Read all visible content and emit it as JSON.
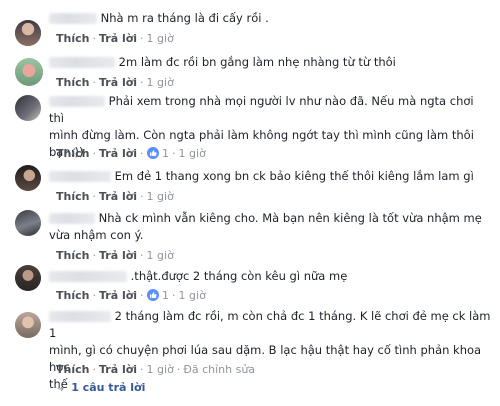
{
  "comments": [
    {
      "lines": [
        "Nhà m ra tháng là đi cấy rồi ."
      ],
      "like": "Thích",
      "reply": "Trả lời",
      "time": "1 giờ",
      "likes": null,
      "edited": null
    },
    {
      "lines": [
        "2m làm đc rồi bn gắng làm nhẹ nhàng từ từ thôi"
      ],
      "like": "Thích",
      "reply": "Trả lời",
      "time": "1 giờ",
      "likes": null,
      "edited": null
    },
    {
      "lines": [
        "Phải xem trong nhà mọi người lv như nào đã. Nếu mà ngta chơi thì",
        "mình đừng làm. Còn ngta phải làm không ngớt tay thì mình cũng làm thôi",
        "bạn:))"
      ],
      "like": "Thích",
      "reply": "Trả lời",
      "time": "1 giờ",
      "likes": "1",
      "edited": null
    },
    {
      "lines": [
        "Em đẻ 1 thang xong bn ck bảo kiêng thế thôi kiêng lắm lam gì"
      ],
      "like": "Thích",
      "reply": "Trả lời",
      "time": "1 giờ",
      "likes": null,
      "edited": null
    },
    {
      "lines": [
        "Nhà ck mình vẫn kiêng cho. Mà bạn nên kiêng là tốt vừa nhậm mẹ",
        "vừa nhậm con ý."
      ],
      "like": "Thích",
      "reply": "Trả lời",
      "time": "1 giờ",
      "likes": null,
      "edited": null
    },
    {
      "lines": [
        ".thật.được 2 tháng còn kêu gì nữa mẹ"
      ],
      "like": "Thích",
      "reply": "Trả lời",
      "time": "1 giờ",
      "likes": "1",
      "edited": null
    },
    {
      "lines": [
        "2 tháng làm đc rồi, m còn chả đc 1 tháng. K lẽ chơi đẻ mẹ ck làm 1",
        "mình, gì có chuyện phơi lúa sau dặm. B lạc hậu thật hay cố tình phản khoa học",
        "thế"
      ],
      "like": "Thích",
      "reply": "Trả lời",
      "time": "1 giờ",
      "likes": null,
      "edited": "Đã chỉnh sửa"
    }
  ],
  "replies_link": "1 câu trả lời",
  "colors": {
    "link": "#365899",
    "meta": "#90949c",
    "like_badge": "#5890ff"
  }
}
